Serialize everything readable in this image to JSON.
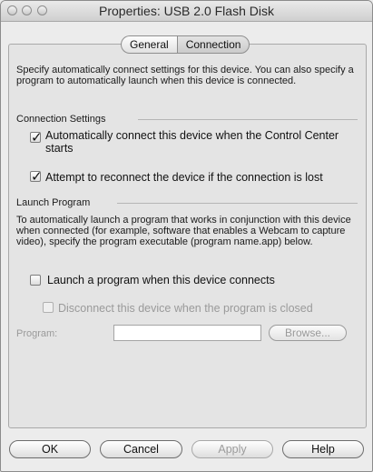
{
  "window": {
    "title": "Properties: USB 2.0 Flash Disk"
  },
  "tabs": [
    {
      "label": "General",
      "selected": false
    },
    {
      "label": "Connection",
      "selected": true
    }
  ],
  "intro": "Specify automatically connect settings for this device. You can also specify a program to automatically launch when this device is connected.",
  "connection_settings": {
    "heading": "Connection Settings",
    "auto_connect": {
      "label": "Automatically connect this device when the Control Center starts",
      "checked": true
    },
    "reconnect": {
      "label": "Attempt to reconnect the device if the connection is lost",
      "checked": true
    }
  },
  "launch_program": {
    "heading": "Launch Program",
    "description": "To automatically launch a program that works in conjunction with this device when connected (for example, software that enables a Webcam to capture video), specify the program executable (program name.app) below.",
    "launch_checkbox": {
      "label": "Launch a program when this device connects",
      "checked": false
    },
    "disconnect_checkbox": {
      "label": "Disconnect this device when the program is closed",
      "checked": false,
      "enabled": false
    },
    "program_label": "Program:",
    "program_value": "",
    "browse_label": "Browse..."
  },
  "buttons": {
    "ok": "OK",
    "cancel": "Cancel",
    "apply": "Apply",
    "help": "Help"
  }
}
